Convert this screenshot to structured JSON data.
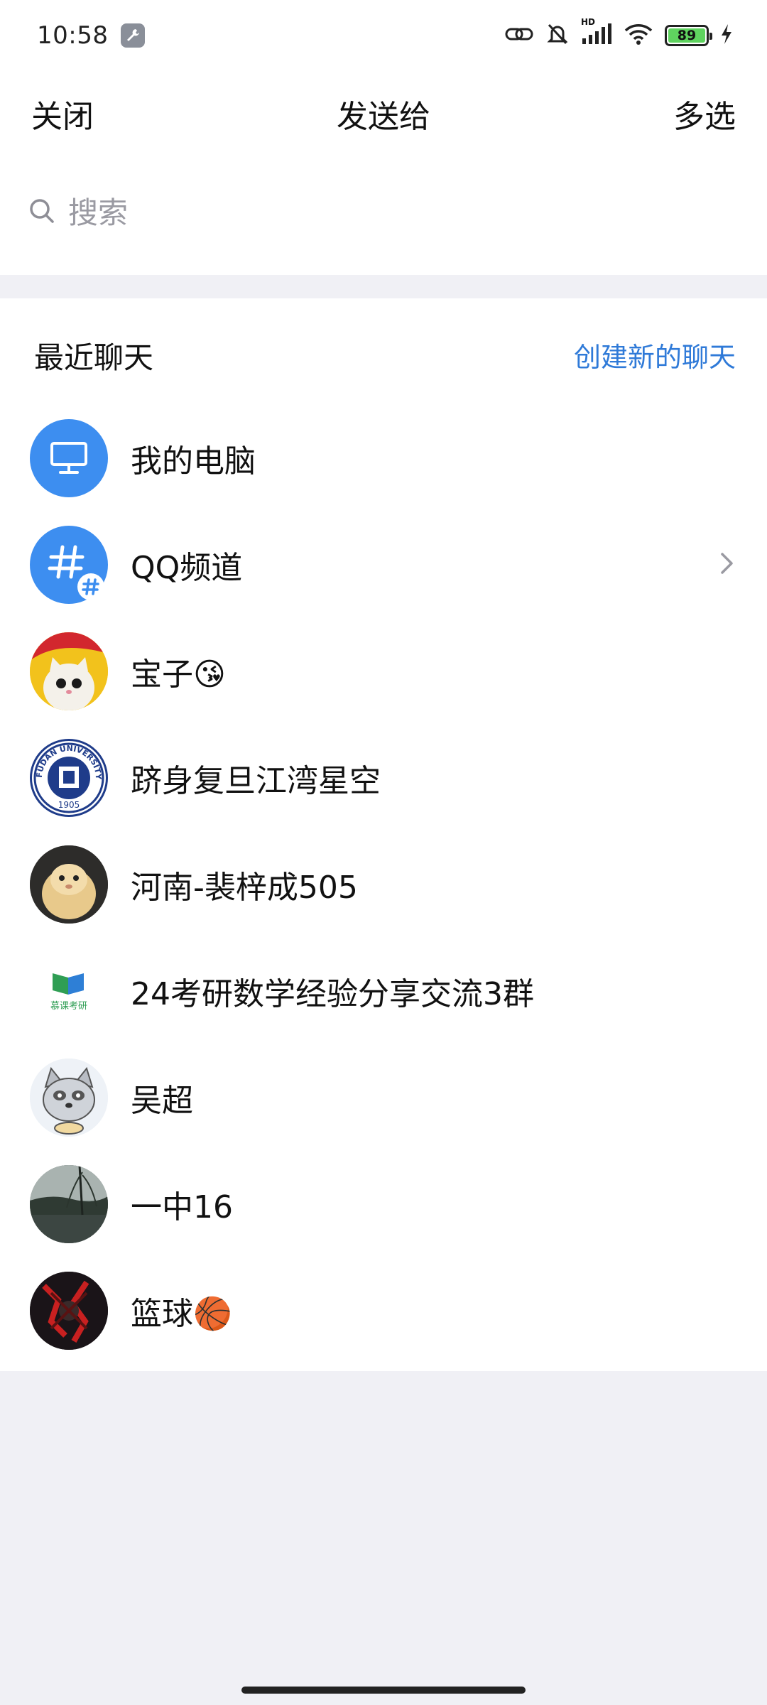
{
  "status_bar": {
    "time": "10:58",
    "battery_level": "89",
    "icons": [
      "wrench-icon",
      "link-icon",
      "bell-muted-icon",
      "signal-icon",
      "wifi-icon",
      "battery-icon",
      "charging-icon"
    ],
    "hd_label": "HD"
  },
  "header": {
    "close_label": "关闭",
    "title": "发送给",
    "multi_select_label": "多选"
  },
  "search": {
    "placeholder": "搜索"
  },
  "recent": {
    "section_title": "最近聊天",
    "create_label": "创建新的聊天",
    "items": [
      {
        "name": "我的电脑",
        "avatar": "computer-icon"
      },
      {
        "name": "QQ频道",
        "avatar": "channel-hash-icon"
      },
      {
        "name": "宝子😘",
        "avatar": "cat-avatar"
      },
      {
        "name": "跻身复旦江湾星空",
        "avatar": "fudan-logo-avatar"
      },
      {
        "name": "河南-裴梓成505",
        "avatar": "hamster-avatar"
      },
      {
        "name": "24考研数学经验分享交流3群",
        "avatar": "mooc-logo-avatar"
      },
      {
        "name": "吴超",
        "avatar": "raccoon-avatar"
      },
      {
        "name": "一中16",
        "avatar": "lake-photo-avatar"
      },
      {
        "name": "篮球🏀",
        "avatar": "dark-art-avatar"
      }
    ]
  },
  "avatar_text": {
    "fudan_ring": "FUDAN UNIVERSITY",
    "fudan_year": "1905",
    "mooc_label": "慕课考研"
  },
  "colors": {
    "accent_blue": "#2f7ad8",
    "avatar_blue": "#3d8ef0",
    "background": "#f0f0f5"
  }
}
